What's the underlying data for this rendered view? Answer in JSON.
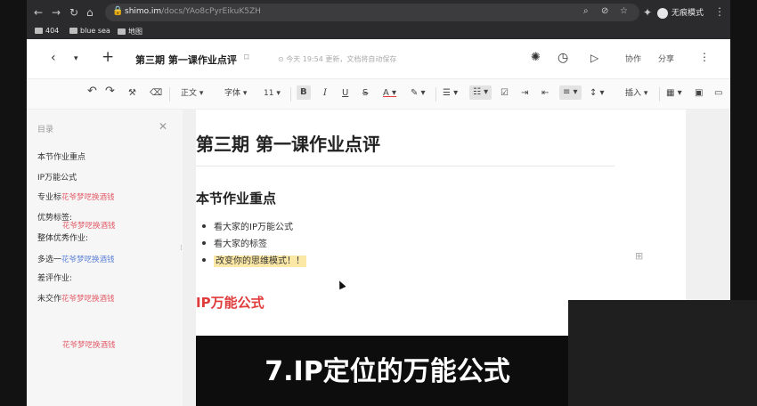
{
  "browser": {
    "url_host": "shimo.im",
    "url_path": "/docs/YAo8cPyrEikuK5ZH",
    "incognito_label": "无痕模式",
    "bookmarks": [
      "404",
      "blue sea",
      "地图"
    ]
  },
  "doc_header": {
    "title": "第三期 第一课作业点评",
    "saved_status": "今天 19:54 更新，文档将自动保存",
    "collab_label": "协作",
    "share_label": "分享"
  },
  "toolbar": {
    "style_label": "正文",
    "font_label": "字体",
    "size_label": "11",
    "insert_label": "插入"
  },
  "toc": {
    "title": "目录",
    "items": [
      {
        "label": "本节作业重点",
        "suffix": ""
      },
      {
        "label": "IP万能公式",
        "suffix": ""
      },
      {
        "label": "专业标",
        "suffix": "花爷梦呓换酒钱"
      },
      {
        "label": "优势标签:",
        "suffix": ""
      },
      {
        "label": "整体优秀作业:",
        "suffix": ""
      },
      {
        "label": "多选一",
        "suffix": "花爷梦呓换酒钱"
      },
      {
        "label": "差评作业:",
        "suffix": ""
      },
      {
        "label": "未交作",
        "suffix": "花爷梦呓换酒钱"
      }
    ],
    "watermarks": [
      "花爷梦呓换酒钱",
      "花爷梦呓换酒钱",
      "花爷梦呓换酒钱"
    ]
  },
  "document": {
    "h1": "第三期 第一课作业点评",
    "h2": "本节作业重点",
    "bullets": [
      "看大家的IP万能公式",
      "看大家的标签",
      "改变你的思维模式！！"
    ],
    "section2_title": "IP万能公式",
    "video_text": "7.IP定位的万能公式"
  },
  "colors": {
    "accent_red": "#e03b3b",
    "highlight": "#fbe8a6",
    "watermark_red": "#e25a66",
    "watermark_blue": "#5b7fd6"
  }
}
